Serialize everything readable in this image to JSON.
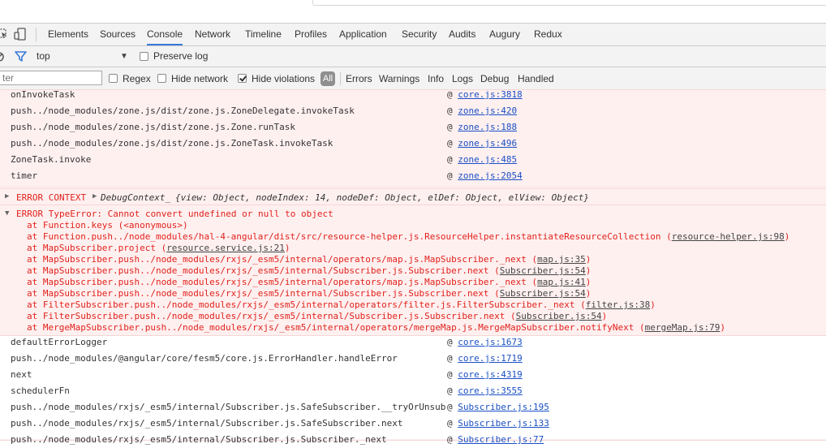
{
  "tabs": [
    "Elements",
    "Sources",
    "Console",
    "Network",
    "Timeline",
    "Profiles",
    "Application",
    "Security",
    "Audits",
    "Augury",
    "Redux"
  ],
  "active_tab": "Console",
  "context": {
    "value": "top",
    "preserve_log": "Preserve log"
  },
  "filter": {
    "placeholder": "ter",
    "regex": "Regex",
    "hide_network": "Hide network",
    "hide_violations": "Hide violations",
    "all": "All",
    "levels": [
      "Errors",
      "Warnings",
      "Info",
      "Logs",
      "Debug",
      "Handled"
    ]
  },
  "stack_top": [
    {
      "fn": "onInvokeTask",
      "src": "core.js:3818"
    },
    {
      "fn": "push../node_modules/zone.js/dist/zone.js.ZoneDelegate.invokeTask",
      "src": "zone.js:420"
    },
    {
      "fn": "push../node_modules/zone.js/dist/zone.js.Zone.runTask",
      "src": "zone.js:188"
    },
    {
      "fn": "push../node_modules/zone.js/dist/zone.js.ZoneTask.invokeTask",
      "src": "zone.js:496"
    },
    {
      "fn": "ZoneTask.invoke",
      "src": "zone.js:485"
    },
    {
      "fn": "timer",
      "src": "zone.js:2054"
    }
  ],
  "error_context": {
    "label": "ERROR CONTEXT",
    "object": "DebugContext_",
    "details": "{view: Object, nodeIndex: 14, nodeDef: Object, elDef: Object, elView: Object}"
  },
  "error": {
    "message": "ERROR TypeError: Cannot convert undefined or null to object",
    "frames": [
      {
        "text": "at Function.keys (<anonymous>)",
        "src": ""
      },
      {
        "text": "at Function.push../node_modules/hal-4-angular/dist/src/resource-helper.js.ResourceHelper.instantiateResourceCollection (",
        "src": "resource-helper.js:98",
        "end": ")"
      },
      {
        "text": "at MapSubscriber.project (",
        "src": "resource.service.js:21",
        "end": ")"
      },
      {
        "text": "at MapSubscriber.push../node_modules/rxjs/_esm5/internal/operators/map.js.MapSubscriber._next (",
        "src": "map.js:35",
        "end": ")"
      },
      {
        "text": "at MapSubscriber.push../node_modules/rxjs/_esm5/internal/Subscriber.js.Subscriber.next (",
        "src": "Subscriber.js:54",
        "end": ")"
      },
      {
        "text": "at MapSubscriber.push../node_modules/rxjs/_esm5/internal/operators/map.js.MapSubscriber._next (",
        "src": "map.js:41",
        "end": ")"
      },
      {
        "text": "at MapSubscriber.push../node_modules/rxjs/_esm5/internal/Subscriber.js.Subscriber.next (",
        "src": "Subscriber.js:54",
        "end": ")"
      },
      {
        "text": "at FilterSubscriber.push../node_modules/rxjs/_esm5/internal/operators/filter.js.FilterSubscriber._next (",
        "src": "filter.js:38",
        "end": ")"
      },
      {
        "text": "at FilterSubscriber.push../node_modules/rxjs/_esm5/internal/Subscriber.js.Subscriber.next (",
        "src": "Subscriber.js:54",
        "end": ")"
      },
      {
        "text": "at MergeMapSubscriber.push../node_modules/rxjs/_esm5/internal/operators/mergeMap.js.MergeMapSubscriber.notifyNext (",
        "src": "mergeMap.js:79",
        "end": ")"
      }
    ]
  },
  "stack_bottom": [
    {
      "fn": "defaultErrorLogger",
      "src": "core.js:1673"
    },
    {
      "fn": "push../node_modules/@angular/core/fesm5/core.js.ErrorHandler.handleError",
      "src": "core.js:1719"
    },
    {
      "fn": "next",
      "src": "core.js:4319"
    },
    {
      "fn": "schedulerFn",
      "src": "core.js:3555"
    },
    {
      "fn": "push../node_modules/rxjs/_esm5/internal/Subscriber.js.SafeSubscriber.__tryOrUnsub",
      "src": "Subscriber.js:195"
    },
    {
      "fn": "push../node_modules/rxjs/_esm5/internal/Subscriber.js.SafeSubscriber.next",
      "src": "Subscriber.js:133"
    },
    {
      "fn": "push../node_modules/rxjs/_esm5/internal/Subscriber.js.Subscriber._next",
      "src": "Subscriber.js:77"
    }
  ]
}
